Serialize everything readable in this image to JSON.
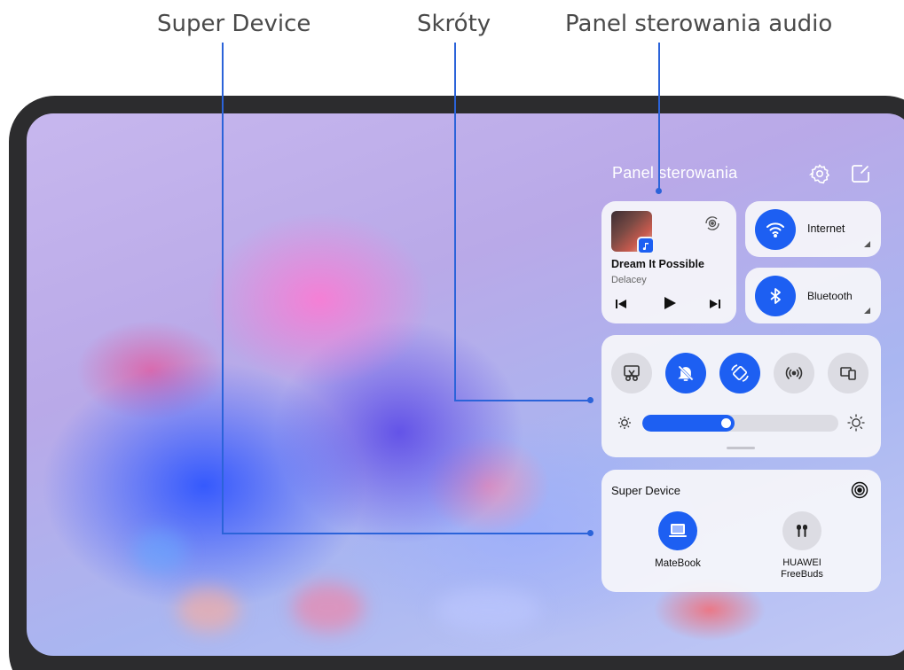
{
  "callouts": {
    "super_device": "Super Device",
    "shortcuts": "Skróty",
    "audio_panel": "Panel sterowania audio"
  },
  "control_panel": {
    "title": "Panel sterowania",
    "settings_icon": "gear-icon",
    "edit_icon": "edit-icon"
  },
  "media": {
    "song_title": "Dream It Possible",
    "artist": "Delacey",
    "app_badge_icon": "music-note-icon",
    "output_icon": "audio-output-icon",
    "prev_icon": "skip-previous-icon",
    "play_icon": "play-icon",
    "next_icon": "skip-next-icon"
  },
  "tiles": {
    "internet_label": "Internet",
    "bluetooth_label": "Bluetooth"
  },
  "shortcuts": [
    {
      "icon": "screenshot-icon",
      "active": false
    },
    {
      "icon": "bell-off-icon",
      "active": true
    },
    {
      "icon": "auto-rotate-icon",
      "active": true
    },
    {
      "icon": "hotspot-icon",
      "active": false
    },
    {
      "icon": "multi-screen-icon",
      "active": false
    }
  ],
  "brightness": {
    "level": 0.47
  },
  "super_device": {
    "title": "Super Device",
    "devices": [
      {
        "name": "MateBook",
        "icon": "laptop-icon"
      },
      {
        "name": "HUAWEI\nFreeBuds",
        "icon": "earbuds-icon"
      }
    ]
  },
  "colors": {
    "accent": "#1d5ff2",
    "callout": "#2b63d9"
  }
}
